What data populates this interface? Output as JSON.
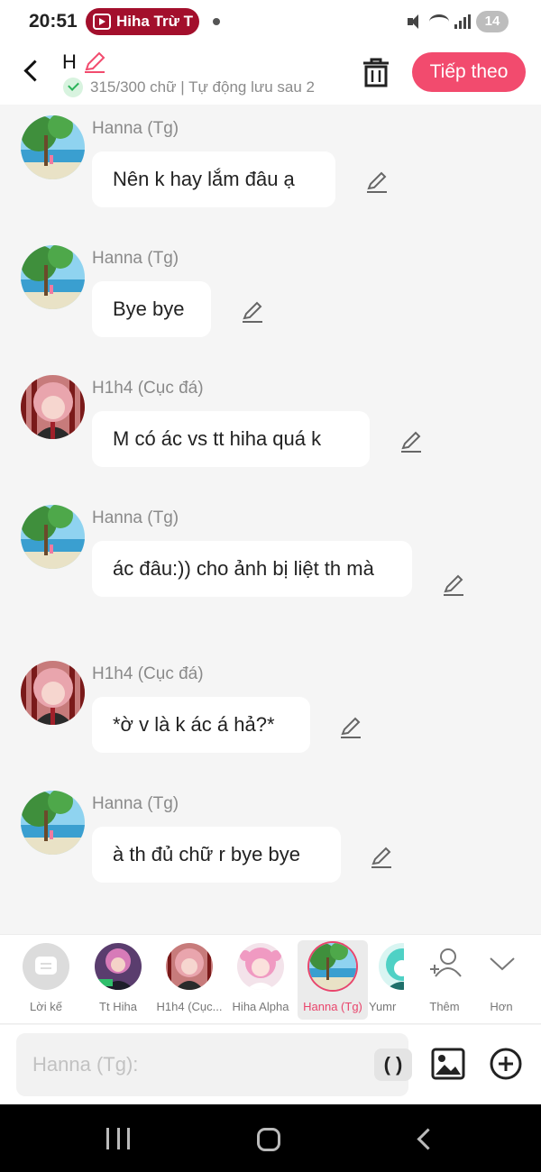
{
  "status_bar": {
    "time": "20:51",
    "app_pill": "Hiha Trừ T",
    "battery": "14"
  },
  "header": {
    "title": "H",
    "word_count": "315/300 chữ | Tự động lưu sau 2",
    "next_label": "Tiếp theo",
    "accent": "#f24b6e"
  },
  "messages": [
    {
      "sender": "Hanna (Tg)",
      "text": "Nên k hay lắm đâu ạ",
      "avatar": "landscape-avatar"
    },
    {
      "sender": "Hanna (Tg)",
      "text": "Bye bye",
      "avatar": "landscape-avatar"
    },
    {
      "sender": "H1h4 (Cục đá)",
      "text": "M có ác vs tt hiha quá k",
      "avatar": "pink-hair-avatar"
    },
    {
      "sender": "Hanna (Tg)",
      "text": "ác đâu:)) cho ảnh bị liệt th mà",
      "avatar": "landscape-avatar"
    },
    {
      "sender": "H1h4 (Cục đá)",
      "text": "*ờ v là k ác á hả?*",
      "avatar": "pink-hair-avatar"
    },
    {
      "sender": "Hanna (Tg)",
      "text": "à th đủ chữ r bye bye",
      "avatar": "landscape-avatar"
    }
  ],
  "characters": [
    {
      "label": "Lời kế",
      "kind": "suggest"
    },
    {
      "label": "Tt Hiha",
      "kind": "dark"
    },
    {
      "label": "H1h4 (Cục...",
      "kind": "pink"
    },
    {
      "label": "Hiha Alpha",
      "kind": "alpha"
    },
    {
      "label": "Hanna (Tg)",
      "kind": "landscape",
      "selected": true
    },
    {
      "label": "Yumr",
      "kind": "cyan"
    }
  ],
  "actions": {
    "add_label": "Thêm",
    "more_label": "Hơn"
  },
  "input": {
    "placeholder": "Hanna (Tg):",
    "paren_label": "( )"
  }
}
